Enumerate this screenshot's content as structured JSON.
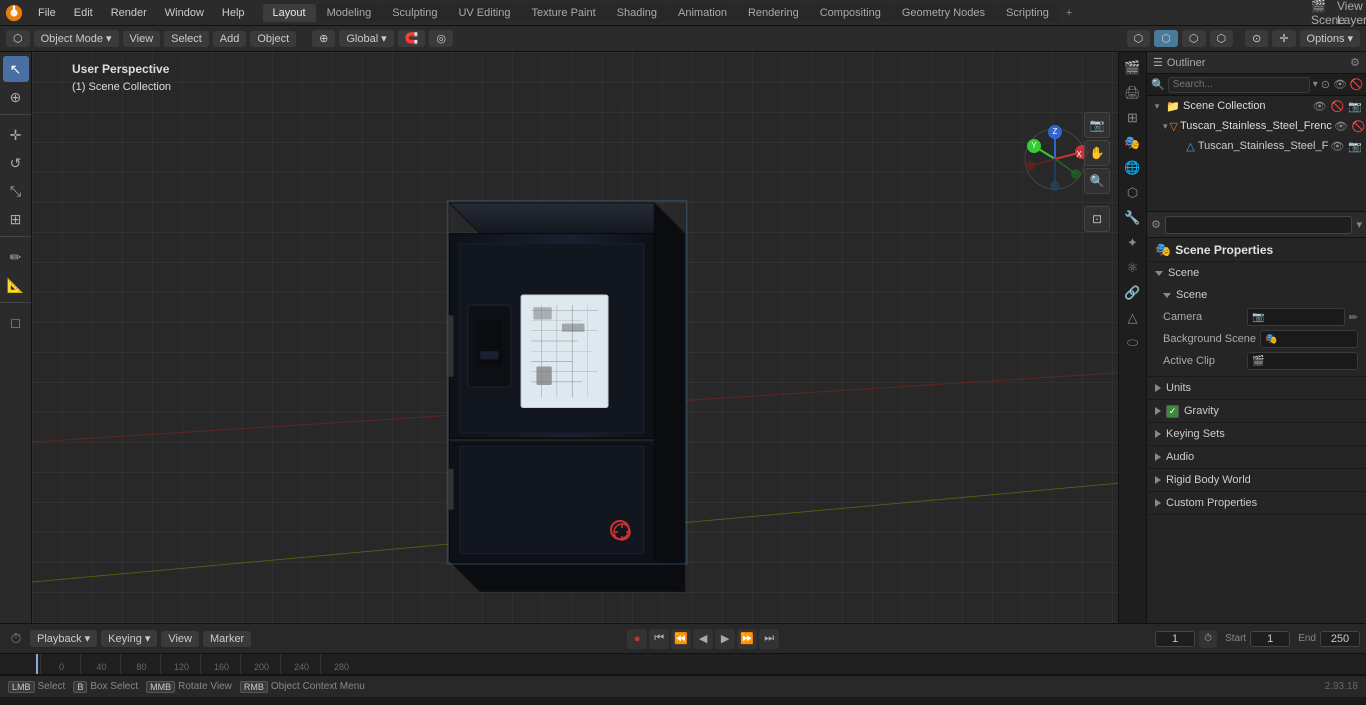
{
  "app": {
    "title": "Blender",
    "version": "2.93.18"
  },
  "top_menu": {
    "items": [
      "File",
      "Edit",
      "Render",
      "Window",
      "Help"
    ]
  },
  "workspace_tabs": {
    "tabs": [
      "Layout",
      "Modeling",
      "Sculpting",
      "UV Editing",
      "Texture Paint",
      "Shading",
      "Animation",
      "Rendering",
      "Compositing",
      "Geometry Nodes",
      "Scripting"
    ],
    "active": "Layout"
  },
  "vp_header": {
    "mode": "Object Mode",
    "view_label": "View",
    "select_label": "Select",
    "add_label": "Add",
    "object_label": "Object",
    "transform": "Global",
    "options_label": "Options"
  },
  "viewport": {
    "info_line1": "User Perspective",
    "info_line2": "(1) Scene Collection"
  },
  "outliner": {
    "title": "Outliner",
    "search_placeholder": "Search...",
    "items": [
      {
        "name": "Scene Collection",
        "icon": "📁",
        "level": 0,
        "expanded": true
      },
      {
        "name": "Tuscan_Stainless_Steel_Frenc",
        "icon": "▽",
        "level": 1,
        "expanded": true
      },
      {
        "name": "Tuscan_Stainless_Steel_F",
        "icon": "△",
        "level": 2,
        "expanded": false
      }
    ]
  },
  "properties": {
    "title": "Scene Properties",
    "search_placeholder": "",
    "header_scene": "Scene Collection",
    "section_scene": {
      "label": "Scene",
      "subsection_label": "Scene",
      "camera_label": "Camera",
      "camera_value": "",
      "background_scene_label": "Background Scene",
      "active_clip_label": "Active Clip"
    },
    "section_units": {
      "label": "Units"
    },
    "section_gravity": {
      "label": "Gravity",
      "checked": true
    },
    "section_keying_sets": {
      "label": "Keying Sets"
    },
    "section_audio": {
      "label": "Audio"
    },
    "section_rigid_body": {
      "label": "Rigid Body World"
    },
    "section_custom_props": {
      "label": "Custom Properties"
    }
  },
  "timeline": {
    "playback_label": "Playback",
    "keying_label": "Keying",
    "view_label": "View",
    "marker_label": "Marker",
    "frame_current": "1",
    "start_label": "Start",
    "start_value": "1",
    "end_label": "End",
    "end_value": "250"
  },
  "ruler": {
    "marks": [
      "0",
      "40",
      "80",
      "120",
      "160",
      "200",
      "240",
      "280"
    ]
  },
  "statusbar": {
    "select_key": "Select",
    "box_select_key": "Box Select",
    "rotate_label": "Rotate View",
    "context_menu_label": "Object Context Menu",
    "version": "2.93.18"
  }
}
